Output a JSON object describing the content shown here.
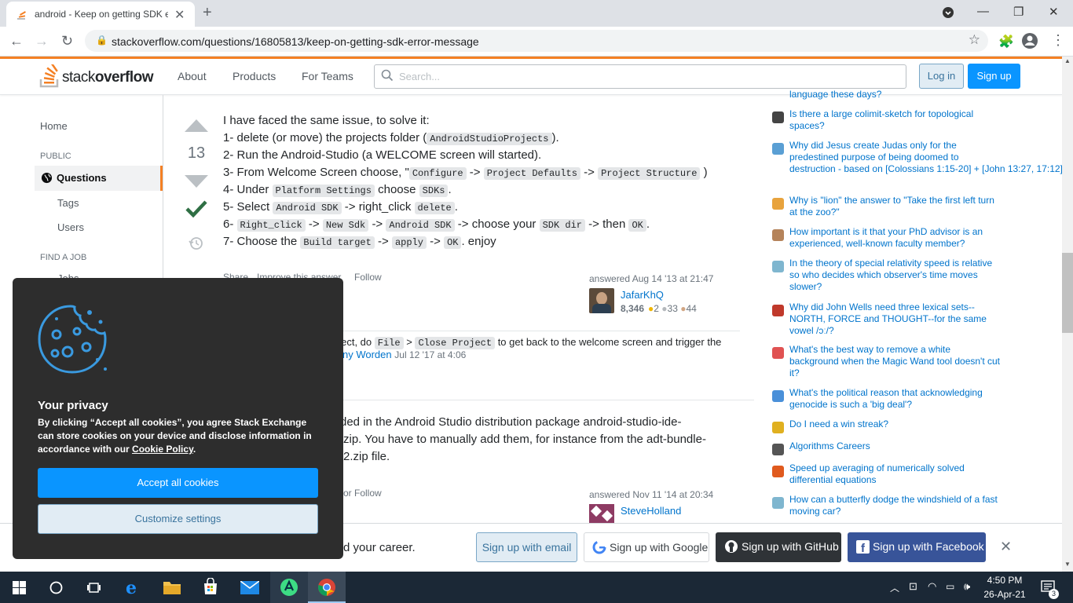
{
  "browser": {
    "tab_title": "android - Keep on getting SDK e",
    "url": "stackoverflow.com/questions/16805813/keep-on-getting-sdk-error-message"
  },
  "header": {
    "logo_text_a": "stack",
    "logo_text_b": "overflow",
    "nav": [
      "About",
      "Products",
      "For Teams"
    ],
    "search_placeholder": "Search...",
    "login": "Log in",
    "signup": "Sign up"
  },
  "leftnav": {
    "home": "Home",
    "public": "PUBLIC",
    "questions": "Questions",
    "tags": "Tags",
    "users": "Users",
    "find_job": "FIND A JOB",
    "jobs": "Jobs"
  },
  "answer1": {
    "votes": "13",
    "lines": {
      "l0": "I have faced the same issue, to solve it:",
      "l1a": "1- delete (or move) the projects folder (",
      "l1c": "AndroidStudioProjects",
      "l1b": ").",
      "l2": "2- Run the Android-Studio (a WELCOME screen will started).",
      "l3a": "3- From Welcome Screen choose, \"",
      "l3c1": "Configure",
      "l3s1": "->",
      "l3c2": "Project Defaults",
      "l3s2": "->",
      "l3c3": "Project Structure",
      "l3b": ")",
      "l4a": "4- Under",
      "l4c1": "Platform Settings",
      "l4b": "choose",
      "l4c2": "SDKs",
      "l4d": ".",
      "l5a": "5- Select",
      "l5c1": "Android SDK",
      "l5b": "-> right_click",
      "l5c2": "delete",
      "l5d": ".",
      "l6a": "6-",
      "l6c1": "Right_click",
      "l6s1": "->",
      "l6c2": "New Sdk",
      "l6s2": "->",
      "l6c3": "Android SDK",
      "l6b": "-> choose your",
      "l6c4": "SDK dir",
      "l6d": "-> then",
      "l6c5": "OK",
      "l6e": ".",
      "l7a": "7- Choose the",
      "l7c1": "Build target",
      "l7s1": "->",
      "l7c2": "apply",
      "l7s2": "->",
      "l7c3": "OK",
      "l7b": ". enjoy"
    },
    "actions": {
      "share": "Share",
      "improve": "Improve this answer",
      "follow": "Follow"
    },
    "answered": "answered Aug 14 '13 at 21:47",
    "user": {
      "name": "JafarKhQ",
      "rep": "8,346",
      "gold": "2",
      "silver": "33",
      "bronze": "44"
    },
    "comment": {
      "prefix": "oject, do",
      "code1": "File",
      "sep": ">",
      "code2": "Close Project",
      "rest": "to get back to the welcome screen and trigger the",
      "author": "ny Worden",
      "date": "Jul 12 '17 at 4:06"
    }
  },
  "answer2": {
    "line1": "ded in the Android Studio distribution package android-studio-ide-",
    "line2": "zip. You have to manually add them, for instance from the adt-bundle-",
    "line3": "2.zip file.",
    "actions_tail": "or",
    "follow": "Follow",
    "answered": "answered Nov 11 '14 at 20:34",
    "user": {
      "name": "SteveHolland"
    }
  },
  "hot": {
    "top_partial": "language these days?",
    "items": [
      {
        "icon": "mo-icon",
        "color": "#444",
        "line1": "Is there a large colimit-sketch for topological",
        "line2": "spaces?",
        "line3": ""
      },
      {
        "icon": "bh-icon",
        "color": "#5a9fd4",
        "line1": "Why did Jesus create Judas only for the",
        "line2": "predestined purpose of being doomed to",
        "line3": "destruction - based on [Colossians 1:15-20] + [John 13:27, 17:12]?"
      },
      {
        "icon": "puzzle-icon",
        "color": "#e8a33d",
        "line1": "Why is \"lion\" the answer to \"Take the first left turn",
        "line2": "at the zoo?\"",
        "line3": ""
      },
      {
        "icon": "books-icon",
        "color": "#b5835a",
        "line1": "How important is it that your PhD advisor is an",
        "line2": "experienced, well-known faculty member?",
        "line3": ""
      },
      {
        "icon": "physics-icon",
        "color": "#7fb6cf",
        "line1": "In the theory of special relativity speed is relative",
        "line2": "so who decides which observer's time moves",
        "line3": "slower?"
      },
      {
        "icon": "linguistics-icon",
        "color": "#c0392b",
        "line1": "Why did John Wells need three lexical sets--",
        "line2": "NORTH, FORCE and THOUGHT--for the same",
        "line3": "vowel /ɔː/?"
      },
      {
        "icon": "graphic-design-icon",
        "color": "#e05252",
        "line1": "What's the best way to remove a white",
        "line2": "background when the Magic Wand tool doesn't cut",
        "line3": "it?"
      },
      {
        "icon": "politics-icon",
        "color": "#4a90d9",
        "line1": "What's the political reason that acknowledging",
        "line2": "genocide is such a 'big deal'?",
        "line3": ""
      },
      {
        "icon": "medal-icon",
        "color": "#e0b020",
        "line1": "Do I need a win streak?",
        "line2": "",
        "line3": ""
      },
      {
        "icon": "careers-icon",
        "color": "#555",
        "line1": "Algorithms Careers",
        "line2": "",
        "line3": ""
      },
      {
        "icon": "math-icon",
        "color": "#e05a1e",
        "line1": "Speed up averaging of numerically solved",
        "line2": "differential equations",
        "line3": ""
      },
      {
        "icon": "physics-icon",
        "color": "#7fb6cf",
        "line1": "How can a butterfly dodge the windshield of a fast",
        "line2": "moving car?",
        "line3": ""
      }
    ]
  },
  "bottombar": {
    "text": "d your career.",
    "email": "Sign up with email",
    "google": "Sign up with Google",
    "github": "Sign up with GitHub",
    "facebook": "Sign up with Facebook"
  },
  "cookie": {
    "heading": "Your privacy",
    "body": "By clicking “Accept all cookies”, you agree Stack Exchange can store cookies on your device and disclose information in accordance with our",
    "policy": "Cookie Policy",
    "period": ".",
    "accept": "Accept all cookies",
    "customize": "Customize settings"
  },
  "taskbar": {
    "time": "4:50 PM",
    "date": "26-Apr-21",
    "notif": "3"
  }
}
